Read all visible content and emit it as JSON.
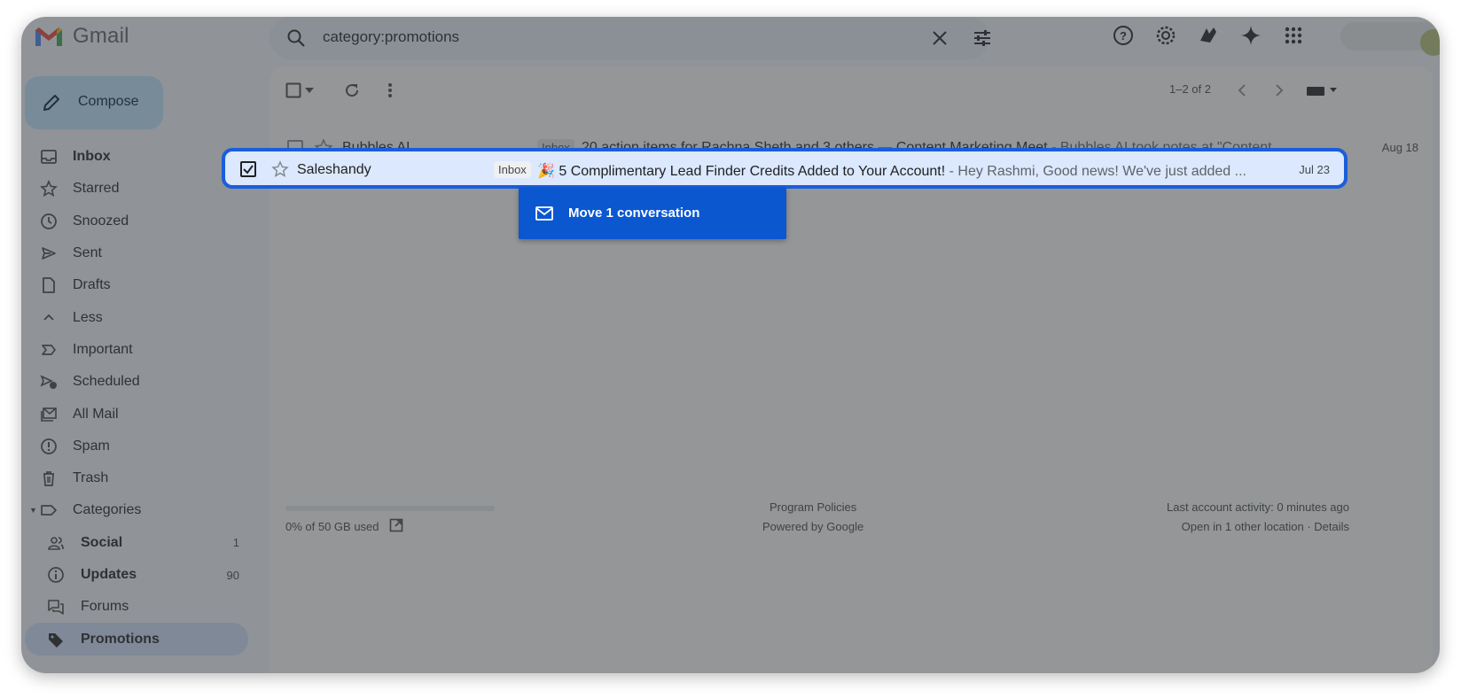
{
  "app": {
    "name": "Gmail"
  },
  "search": {
    "value": "category:promotions"
  },
  "compose": {
    "label": "Compose"
  },
  "sidebar": {
    "items": [
      {
        "label": "Inbox",
        "icon": "inbox-icon",
        "bold": true
      },
      {
        "label": "Starred",
        "icon": "star-icon"
      },
      {
        "label": "Snoozed",
        "icon": "clock-icon"
      },
      {
        "label": "Sent",
        "icon": "send-icon"
      },
      {
        "label": "Drafts",
        "icon": "draft-icon"
      },
      {
        "label": "Less",
        "icon": "chevron-up-icon"
      },
      {
        "label": "Important",
        "icon": "important-icon"
      },
      {
        "label": "Scheduled",
        "icon": "scheduled-icon"
      },
      {
        "label": "All Mail",
        "icon": "all-mail-icon"
      },
      {
        "label": "Spam",
        "icon": "spam-icon"
      },
      {
        "label": "Trash",
        "icon": "trash-icon"
      },
      {
        "label": "Categories",
        "icon": "label-icon"
      }
    ],
    "categories": [
      {
        "label": "Social",
        "count": "1",
        "icon": "people-icon"
      },
      {
        "label": "Updates",
        "count": "90",
        "icon": "info-icon"
      },
      {
        "label": "Forums",
        "count": "",
        "icon": "forum-icon"
      },
      {
        "label": "Promotions",
        "count": "",
        "icon": "tag-icon"
      }
    ]
  },
  "toolbar": {
    "pager": "1–2 of 2"
  },
  "emails": [
    {
      "sender": "Bubbles AI",
      "badge": "Inbox",
      "subject": "20 action items for Rachna Sheth and 3 others — Content Marketing Meet",
      "snippet": " - Bubbles AI took notes at \"Content ...",
      "date": "Aug 18"
    },
    {
      "sender": "Saleshandy",
      "badge": "Inbox",
      "subject": "🎉 5 Complimentary Lead Finder Credits Added to Your Account!",
      "snippet": " - Hey Rashmi, Good news! We've just added ...",
      "date": "Jul 23",
      "selected": true
    }
  ],
  "drag": {
    "label": "Move 1 conversation"
  },
  "footer": {
    "storage": "0% of 50 GB used",
    "policies": "Program Policies",
    "powered": "Powered by Google",
    "activity": "Last account activity: 0 minutes ago",
    "location": "Open in 1 other location · Details"
  },
  "colors": {
    "accent": "#0b57d0",
    "selected_row": "#dbe8fd",
    "compose": "#c2e7ff"
  }
}
